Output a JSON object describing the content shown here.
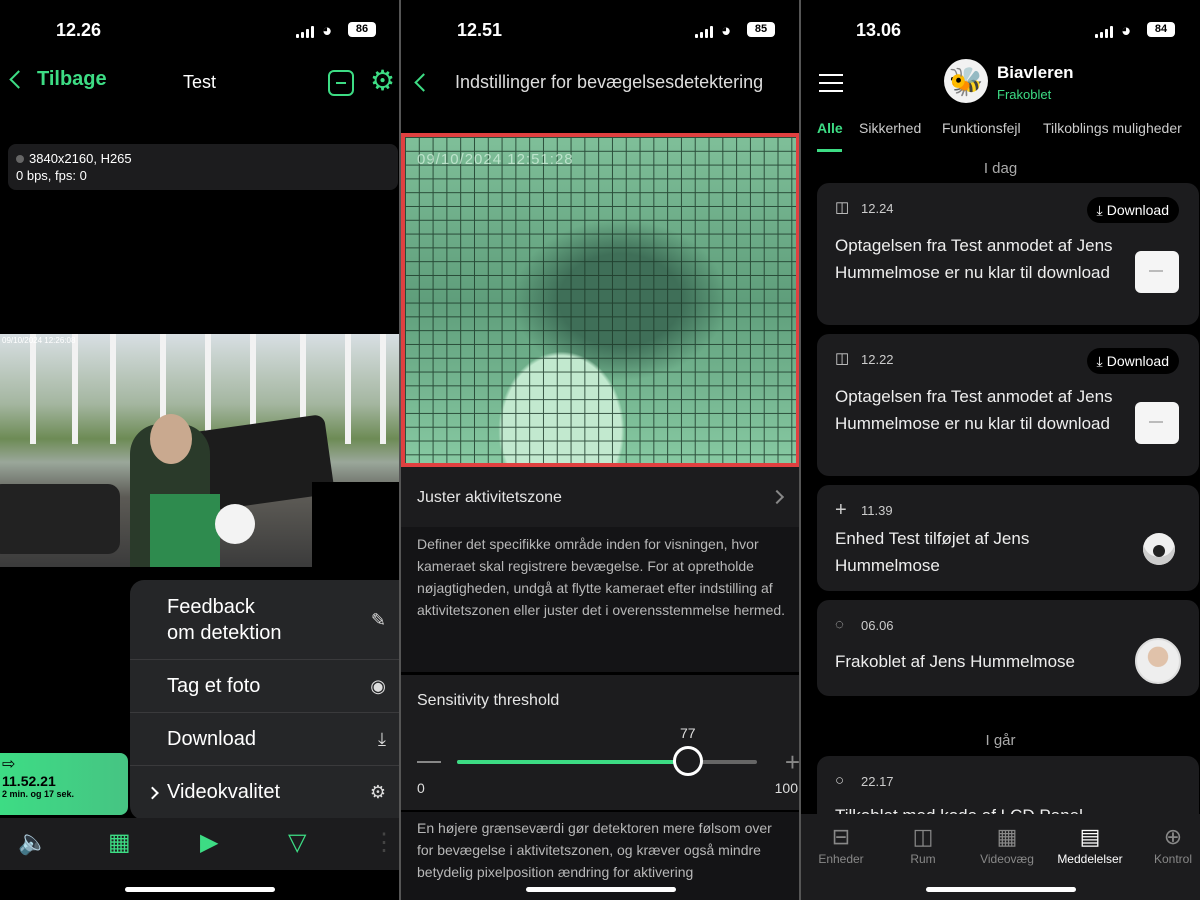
{
  "panel1": {
    "status": {
      "time": "12.26",
      "battery": "86"
    },
    "back_label": "Tilbage",
    "title": "Test",
    "stream": {
      "resolution": "3840x2160, H265",
      "rate": "0 bps, fps: 0"
    },
    "camera_stamp": "09/10/2024 12:26:08",
    "menu": [
      {
        "label": "Feedback\nom detektion",
        "icon": "feedback-icon"
      },
      {
        "label": "Tag et foto",
        "icon": "camera-icon"
      },
      {
        "label": "Download",
        "icon": "download-icon"
      },
      {
        "label": "Videokvalitet",
        "icon": "gear-icon"
      }
    ],
    "timeline": {
      "time": "11.52.21",
      "duration": "2 min. og 17 sek."
    },
    "toolbar": [
      "speaker-icon",
      "calendar-icon",
      "play-icon",
      "filter-icon",
      "more-icon"
    ]
  },
  "panel2": {
    "status": {
      "time": "12.51",
      "battery": "85"
    },
    "title": "Indstillinger for bevægelsesdetektering",
    "zone_stamp": "09/10/2024 12:51:28",
    "adjust_zone_label": "Juster aktivitetszone",
    "adjust_zone_desc": "Definer det specifikke område inden for visningen, hvor kameraet skal registrere bevægelse. For at opretholde nøjagtigheden, undgå at flytte kameraet efter indstilling af aktivitetszonen eller juster det i overensstemmelse hermed.",
    "sensitivity": {
      "label": "Sensitivity threshold",
      "value": "77",
      "value_num": 77,
      "min": "0",
      "max": "100",
      "desc": "En højere grænseværdi gør detektoren mere følsom over for bevægelse i aktivitetszonen, og kræver også mindre betydelig pixelposition ændring for aktivering"
    }
  },
  "panel3": {
    "status": {
      "time": "13.06",
      "battery": "84"
    },
    "hub": {
      "name": "Biavleren",
      "status": "Frakoblet"
    },
    "tabs": [
      "Alle",
      "Sikkerhed",
      "Funktionsfejl",
      "Tilkoblings muligheder"
    ],
    "today_label": "I dag",
    "yesterday_label": "I går",
    "notifications": [
      {
        "time": "12.24",
        "download": "Download",
        "text": "Optagelsen fra Test anmodet af Jens Hummelmose er nu klar til download"
      },
      {
        "time": "12.22",
        "download": "Download",
        "text": "Optagelsen fra Test anmodet af Jens Hummelmose er nu klar til download"
      },
      {
        "time": "11.39",
        "text": "Enhed Test tilføjet af Jens Hummelmose"
      },
      {
        "time": "06.06",
        "text": "Frakoblet af Jens Hummelmose"
      },
      {
        "time": "22.17",
        "text": "Tilkoblet med kode af LCD Panel"
      }
    ],
    "bottom_tabs": [
      {
        "label": "Enheder",
        "icon": "devices-icon"
      },
      {
        "label": "Rum",
        "icon": "rooms-icon"
      },
      {
        "label": "Videovæg",
        "icon": "videowall-icon"
      },
      {
        "label": "Meddelelser",
        "icon": "notifications-icon"
      },
      {
        "label": "Kontrol",
        "icon": "control-icon"
      }
    ]
  },
  "colors": {
    "accent": "#3ddc84",
    "zone_border": "#e04040",
    "card": "#1c1c1e"
  }
}
